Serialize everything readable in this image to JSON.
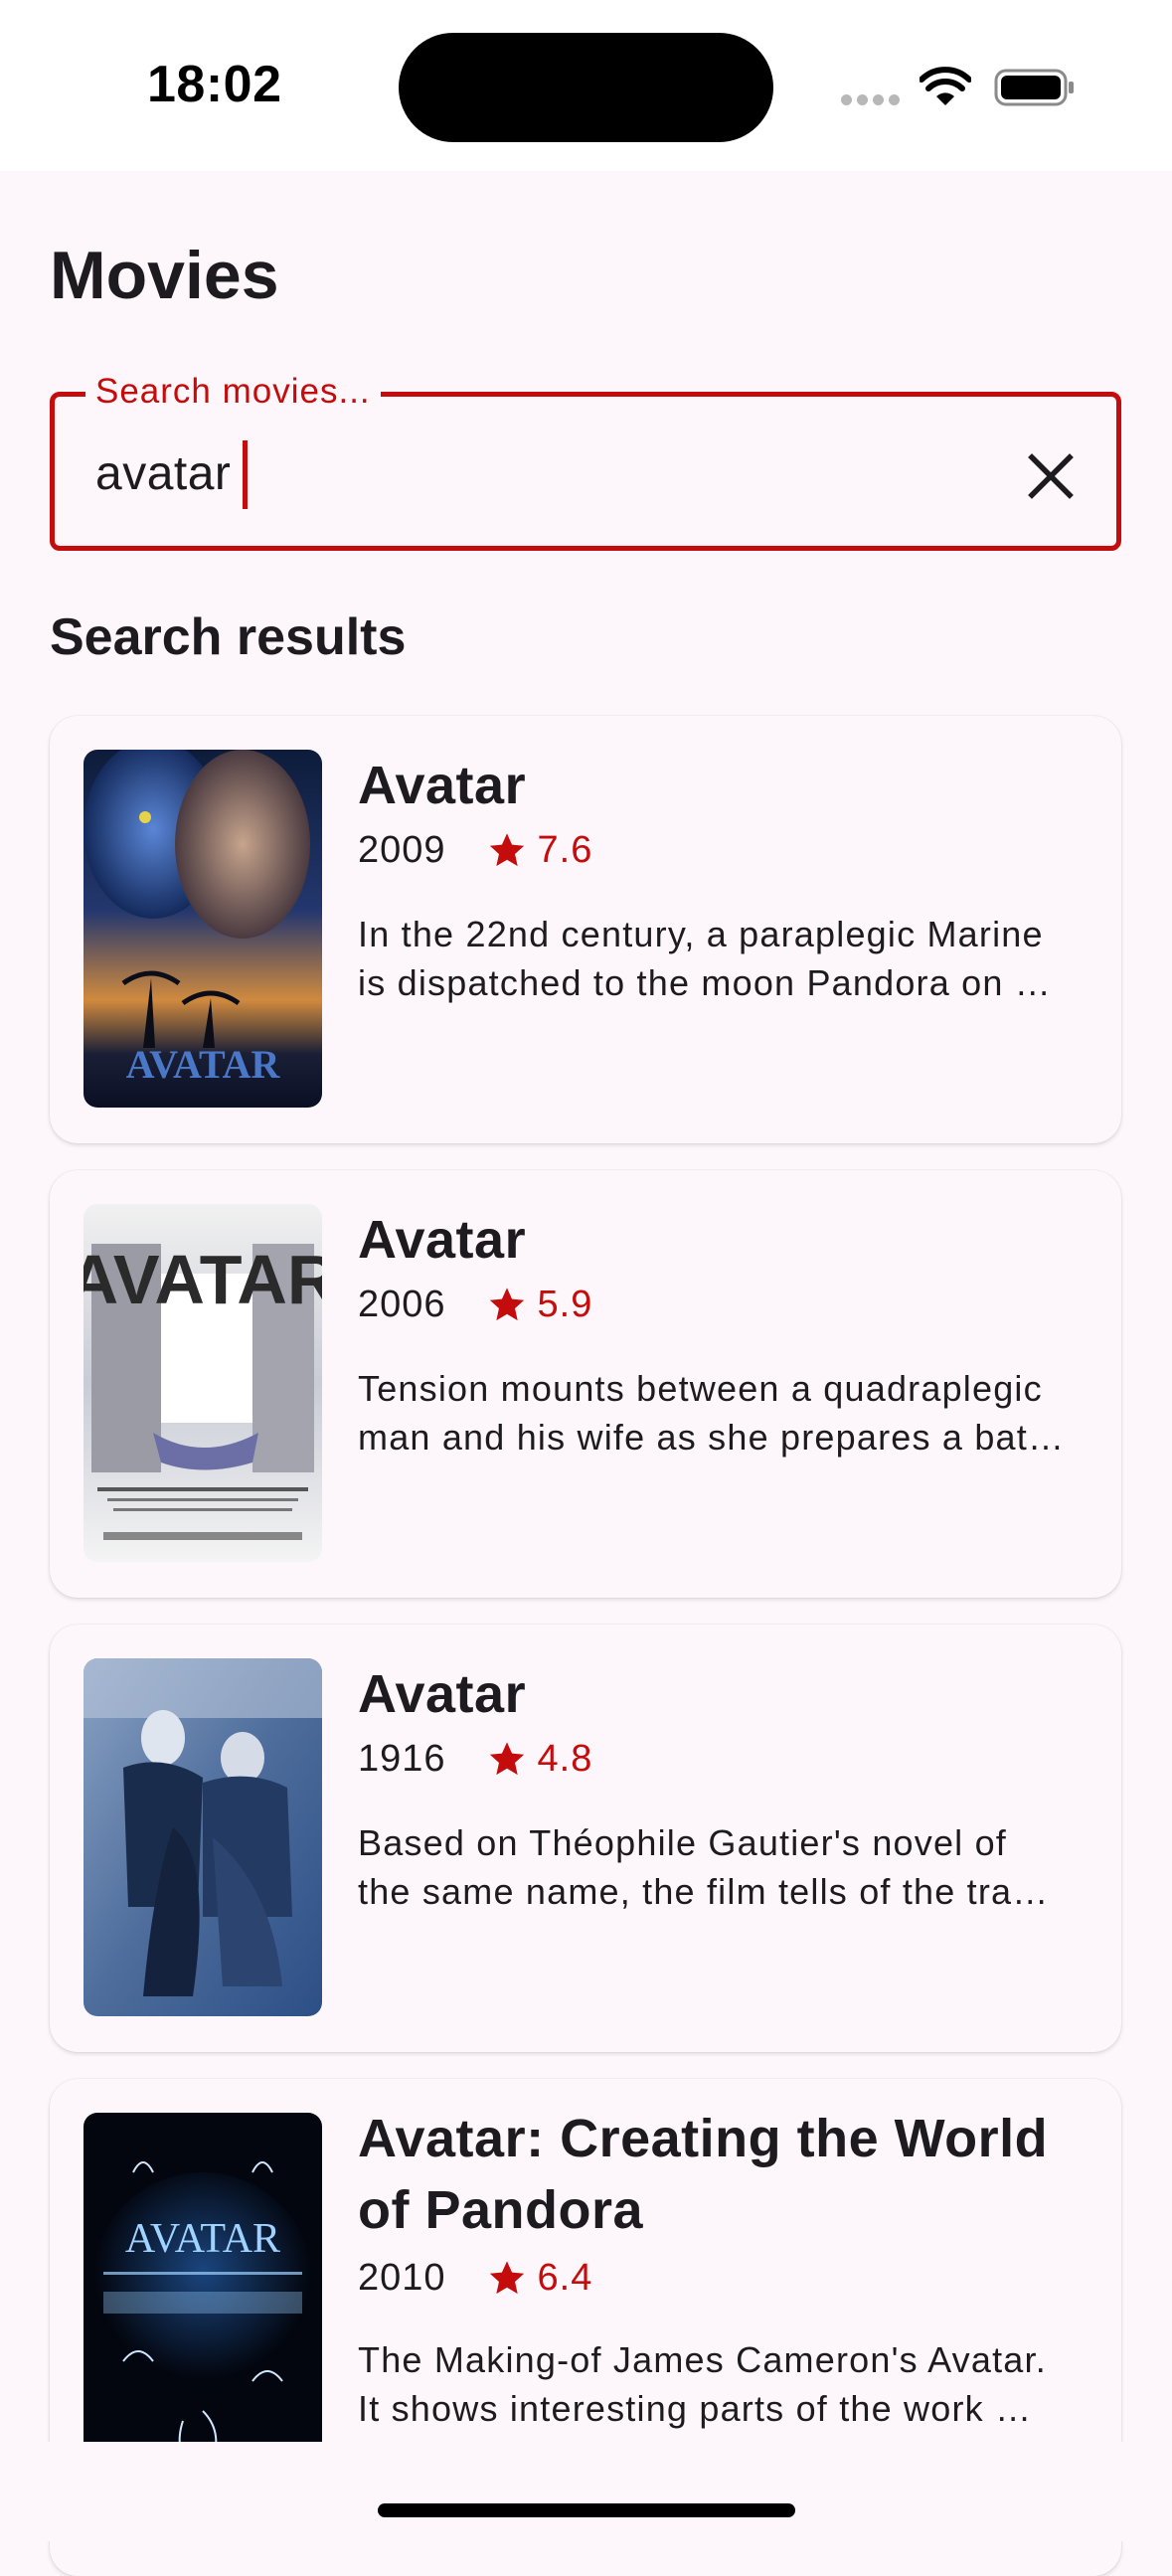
{
  "status_bar": {
    "time": "18:02"
  },
  "page": {
    "title": "Movies",
    "section_title": "Search results"
  },
  "search": {
    "label": "Search movies...",
    "value": "avatar",
    "clear_icon": "close-icon"
  },
  "colors": {
    "accent": "#c50c0c",
    "background": "#fdf7fb",
    "text": "#1d1b20"
  },
  "results": [
    {
      "title": "Avatar",
      "year": "2009",
      "rating": "7.6",
      "overview": "In the 22nd century, a paraplegic Marine\nis dispatched to the moon Pandora on …",
      "poster_text": "AVATAR"
    },
    {
      "title": "Avatar",
      "year": "2006",
      "rating": "5.9",
      "overview": "Tension mounts between a quadraplegic\nman and his wife as she prepares a bat…",
      "poster_text": "AVATAR"
    },
    {
      "title": "Avatar",
      "year": "1916",
      "rating": "4.8",
      "overview": "Based on Théophile Gautier's novel of\nthe same name, the film tells of the tra…",
      "poster_text": ""
    },
    {
      "title": "Avatar: Creating the World of Pandora",
      "year": "2010",
      "rating": "6.4",
      "overview": "The Making-of James Cameron's Avatar.\nIt shows interesting parts of the work …",
      "poster_text": "AVATAR"
    }
  ]
}
